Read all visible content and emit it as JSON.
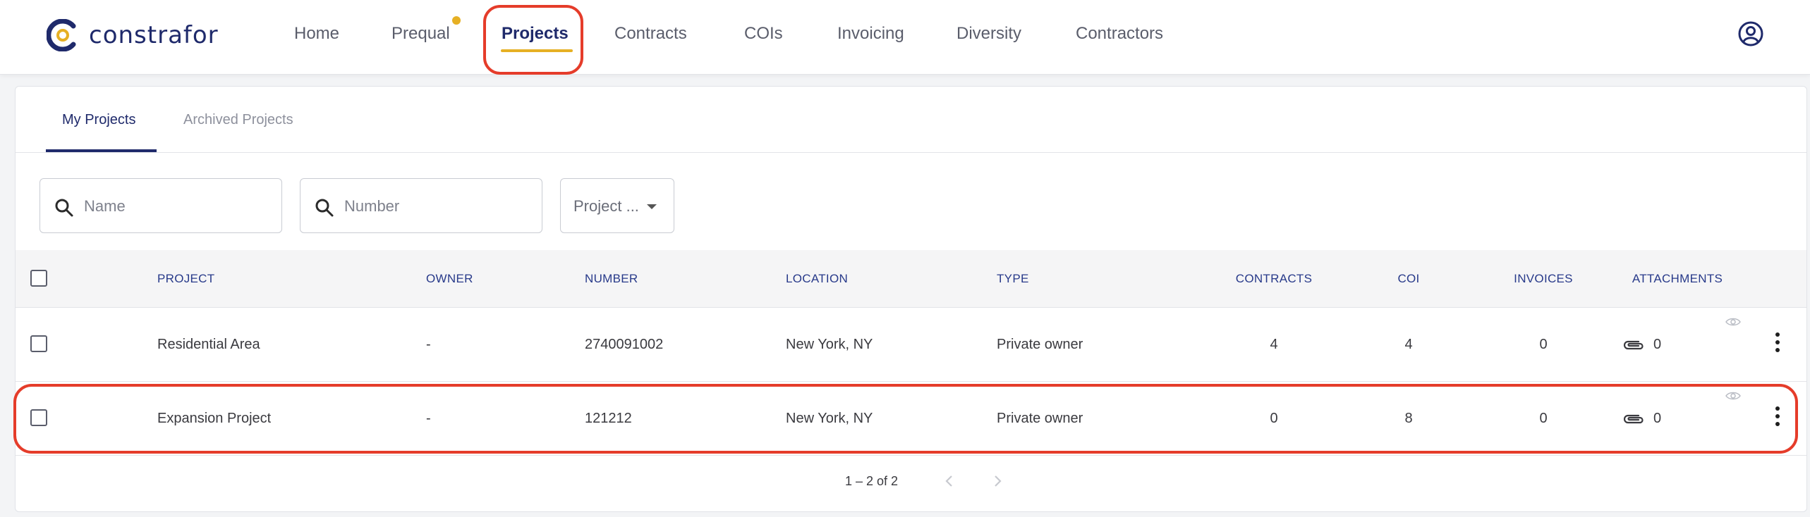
{
  "app": {
    "logo_text": "constrafor"
  },
  "nav": {
    "items": [
      {
        "label": "Home"
      },
      {
        "label": "Prequal"
      },
      {
        "label": "Projects"
      },
      {
        "label": "Contracts"
      },
      {
        "label": "COIs"
      },
      {
        "label": "Invoicing"
      },
      {
        "label": "Diversity"
      },
      {
        "label": "Contractors"
      }
    ],
    "active": "Projects"
  },
  "tabs": [
    {
      "label": "My Projects",
      "active": true
    },
    {
      "label": "Archived Projects",
      "active": false
    }
  ],
  "filters": {
    "name_placeholder": "Name",
    "number_placeholder": "Number",
    "type_select_value": "Project ..."
  },
  "table": {
    "columns": [
      "PROJECT",
      "OWNER",
      "NUMBER",
      "LOCATION",
      "TYPE",
      "CONTRACTS",
      "COI",
      "INVOICES",
      "ATTACHMENTS"
    ],
    "rows": [
      {
        "project": "Residential Area",
        "owner": "-",
        "number": "2740091002",
        "location": "New York, NY",
        "type": "Private owner",
        "contracts": "4",
        "coi": "4",
        "invoices": "0",
        "attachments": "0"
      },
      {
        "project": "Expansion Project",
        "owner": "-",
        "number": "121212",
        "location": "New York, NY",
        "type": "Private owner",
        "contracts": "0",
        "coi": "8",
        "invoices": "0",
        "attachments": "0"
      }
    ]
  },
  "pagination": {
    "range_text": "1 – 2 of 2"
  },
  "colors": {
    "brand_navy": "#1f2a6b",
    "accent_yellow": "#e6b024",
    "highlight_red": "#e53c2a"
  },
  "icons": [
    "search-icon",
    "user-circle-icon",
    "paperclip-icon",
    "eye-icon",
    "more-vert-icon",
    "chevron-left-icon",
    "chevron-right-icon",
    "caret-down-icon"
  ]
}
